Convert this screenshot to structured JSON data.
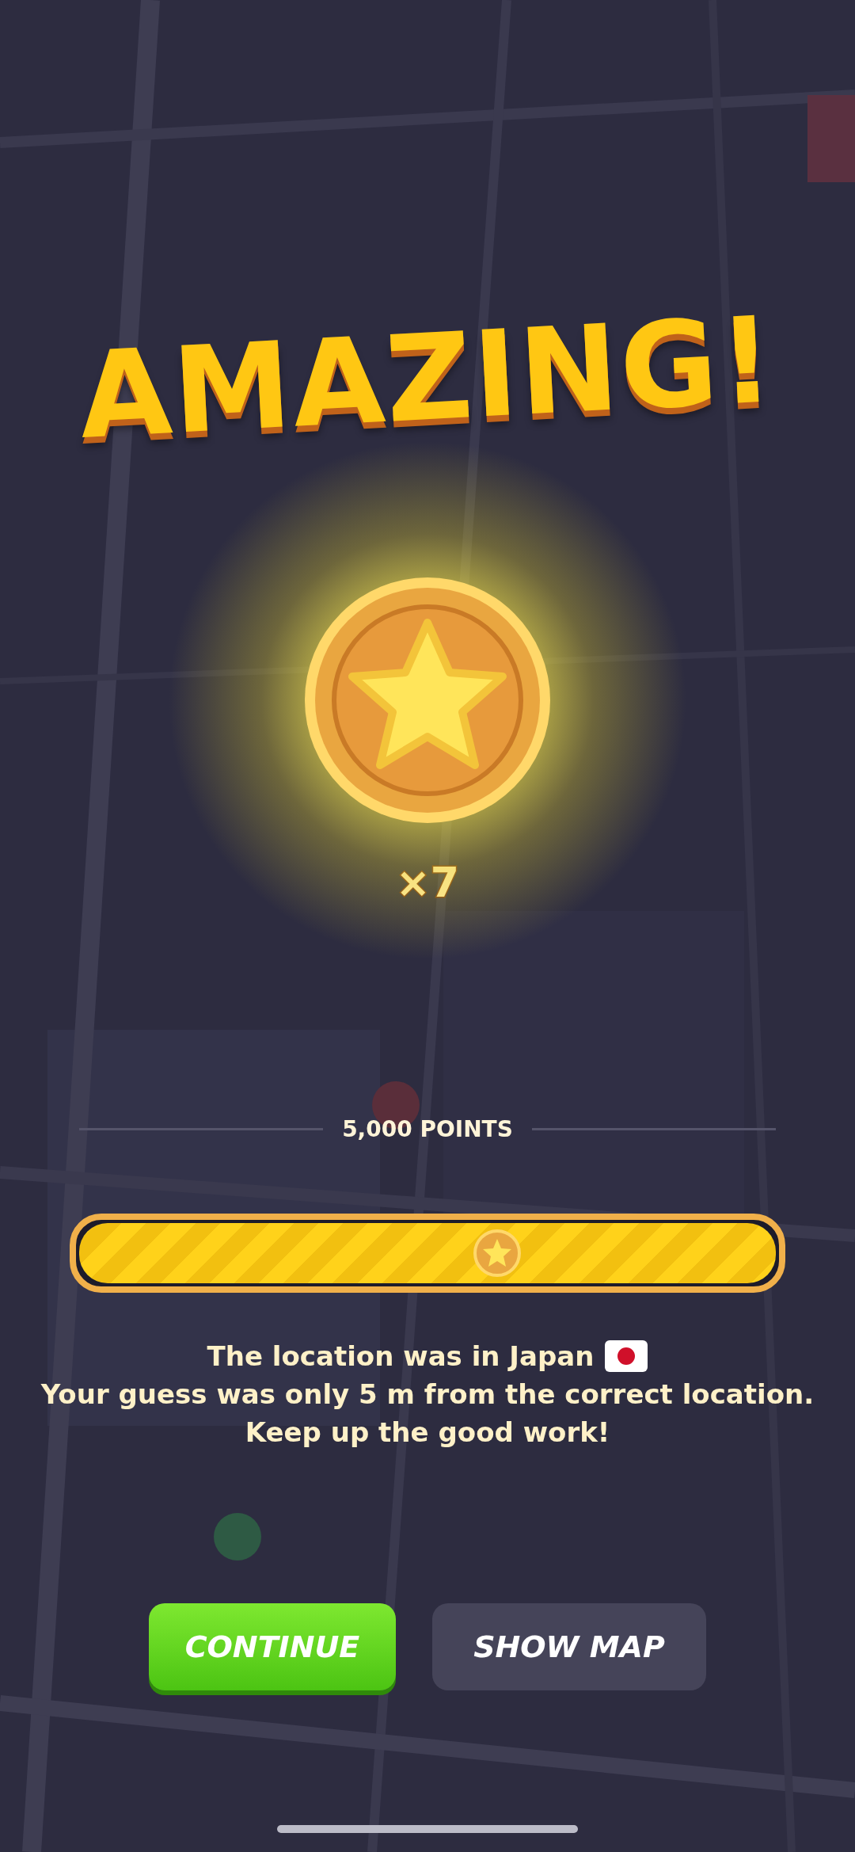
{
  "title": "AMAZING!",
  "reward": {
    "multiplier": "×7"
  },
  "score": {
    "label": "5,000 POINTS",
    "level": 0.6
  },
  "message": {
    "location": "The location was in Japan",
    "guess": "Your guess was only 5 m from the correct location.",
    "praise": "Keep up the good work!"
  },
  "buttons": [
    {
      "label": "CONTINUE",
      "kind": "primary"
    },
    {
      "label": "SHOW MAP",
      "kind": "secondary"
    }
  ]
}
